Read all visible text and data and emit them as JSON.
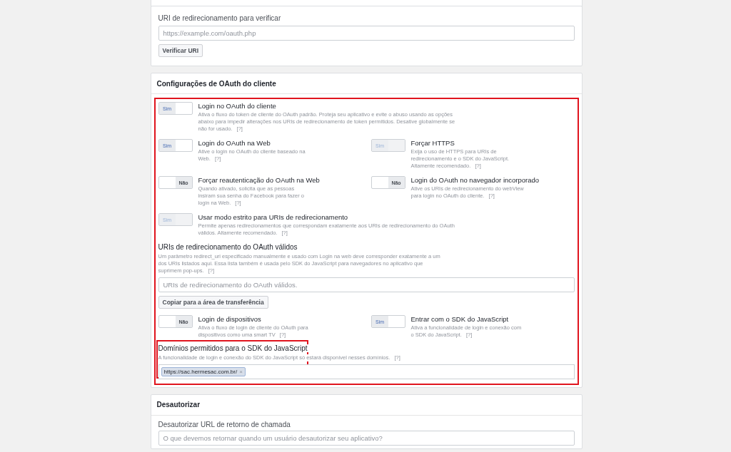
{
  "verify": {
    "label": "URI de redirecionamento para verificar",
    "placeholder": "https://example.com/oauth.php",
    "button": "Verificar URI"
  },
  "oauth": {
    "title": "Configurações de OAuth do cliente",
    "highlighted": true,
    "blocks": [
      {
        "kind": "toggles",
        "rows": [
          [
            {
              "title": "Login no OAuth do cliente",
              "description": "Ativa o fluxo do token de cliente do OAuth padrão. Proteja seu aplicativo e evite o abuso usando as opções abaixo para impedir alterações nos URIs de redirecionamento de token permitidos. Desative globalmente se não for usado.",
              "help": "[?]",
              "state_label": "Sim",
              "on": true,
              "disabled": false
            }
          ],
          [
            {
              "title": "Login do OAuth na Web",
              "description": "Ative o login no OAuth do cliente baseado na Web.",
              "help": "[?]",
              "state_label": "Sim",
              "on": true,
              "disabled": false
            },
            {
              "title": "Forçar HTTPS",
              "description": "Exija o uso de HTTPS para URIs de redirecionamento e o SDK do JavaScript. Altamente recomendado.",
              "help": "[?]",
              "state_label": "Sim",
              "on": true,
              "disabled": true
            }
          ],
          [
            {
              "title": "Forçar reautenticação do OAuth na Web",
              "description": "Quando ativado, solicita que as pessoas insiram sua senha do Facebook para fazer o login na Web.",
              "help": "[?]",
              "state_label": "Não",
              "on": false,
              "disabled": false
            },
            {
              "title": "Login do OAuth no navegador incorporado",
              "description": "Ative os URIs de redirecionamento do webView para login no OAuth do cliente.",
              "help": "[?]",
              "state_label": "Não",
              "on": false,
              "disabled": false
            }
          ],
          [
            {
              "title": "Usar modo estrito para URIs de redirecionamento",
              "description": "Permite apenas redirecionamentos que correspondam exatamente aos URIs de redirecionamento do OAuth válidos. Altamente recomendado.",
              "help": "[?]",
              "state_label": "Sim",
              "on": true,
              "disabled": true
            }
          ]
        ]
      },
      {
        "kind": "uri_list",
        "label": "URIs de redirecionamento do OAuth válidos",
        "description": "Um parâmetro redirect_uri especificado manualmente e usado com Login na web deve corresponder exatamente a um dos URIs listados aqui. Essa lista também é usada pelo SDK do JavaScript para navegadores no aplicativo que suprimem pop-ups.",
        "help": "[?]",
        "placeholder": "URIs de redirecionamento do OAuth válidos.",
        "button": "Copiar para a área de transferência"
      },
      {
        "kind": "toggles",
        "rows": [
          [
            {
              "title": "Login de dispositivos",
              "description": "Ativa o fluxo de login de cliente do OAuth para dispositivos como uma smart TV",
              "help": "[?]",
              "state_label": "Não",
              "on": false,
              "disabled": false
            },
            {
              "title": "Entrar com o SDK do JavaScript",
              "description": "Ativa a funcionalidade de login e conexão com o SDK do JavaScript.",
              "help": "[?]",
              "state_label": "Sim",
              "on": true,
              "disabled": false
            }
          ]
        ]
      },
      {
        "kind": "domains",
        "label": "Domínios permitidos para o SDK do JavaScript",
        "description": "A funcionalidade de login e conexão do SDK do JavaScript só estará disponível nesses domínios.",
        "help": "[?]",
        "highlighted": true,
        "tags": [
          {
            "text": "https://sac.hermesac.com.br/",
            "remove": "×"
          }
        ]
      }
    ]
  },
  "deauthorize": {
    "title": "Desautorizar",
    "label": "Desautorizar URL de retorno de chamada",
    "placeholder": "O que devemos retornar quando um usuário desautorizar seu aplicativo?"
  }
}
